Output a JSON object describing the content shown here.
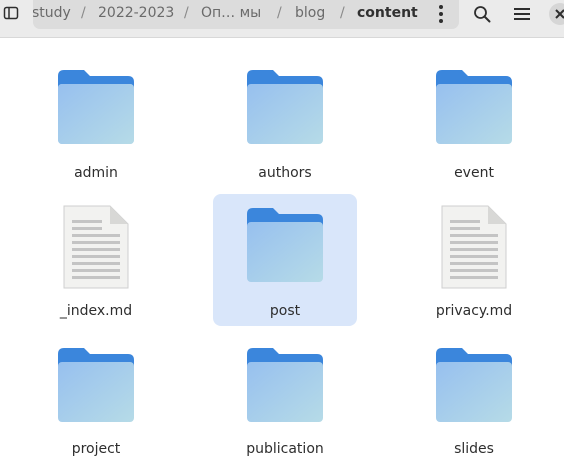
{
  "breadcrumbs": [
    "study",
    "2022-2023",
    "Оп… мы",
    "blog",
    "content"
  ],
  "breadcrumb_separator": "/",
  "icons": {
    "sidebar": "sidebar-toggle-icon",
    "menu": "vertical-dots-icon",
    "search": "search-icon",
    "hamburger": "hamburger-menu-icon",
    "close": "close-icon",
    "folder": "folder-icon",
    "document": "text-document-icon"
  },
  "files": [
    {
      "name": "admin",
      "type": "folder"
    },
    {
      "name": "authors",
      "type": "folder"
    },
    {
      "name": "event",
      "type": "folder"
    },
    {
      "name": "_index.md",
      "type": "document"
    },
    {
      "name": "post",
      "type": "folder",
      "selected": true
    },
    {
      "name": "privacy.md",
      "type": "document"
    },
    {
      "name": "project",
      "type": "folder"
    },
    {
      "name": "publication",
      "type": "folder"
    },
    {
      "name": "slides",
      "type": "folder"
    }
  ],
  "colors": {
    "selection": "#d9e6fa",
    "folder_front": "#a5cbef",
    "folder_back": "#3b86dc"
  }
}
